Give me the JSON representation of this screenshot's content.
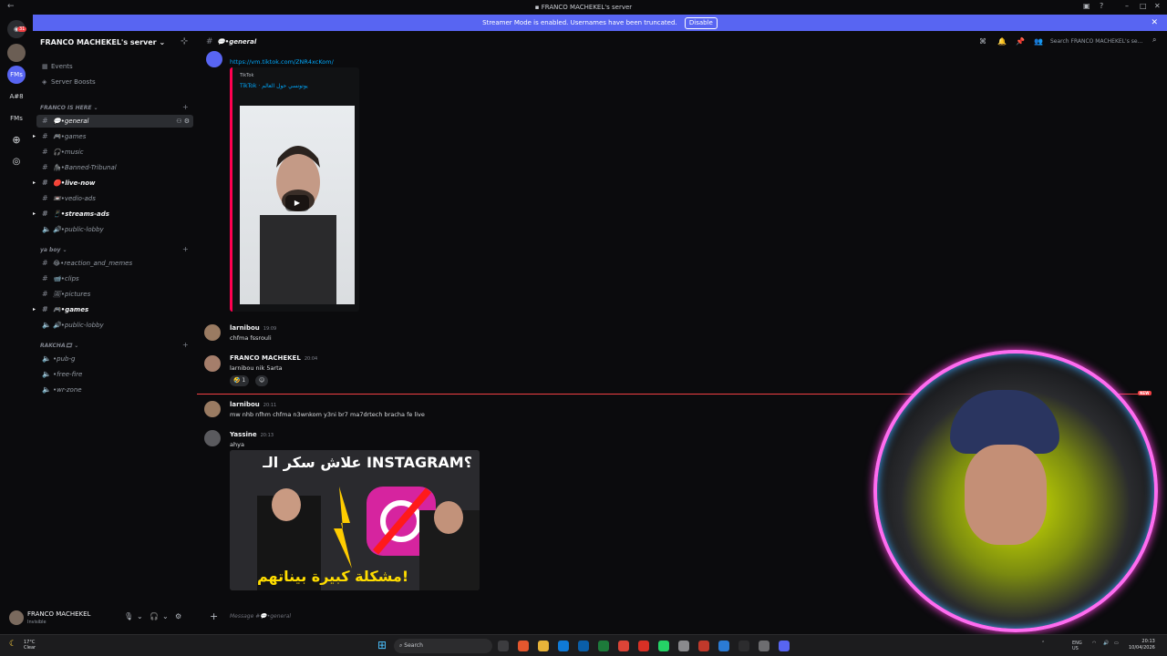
{
  "window": {
    "title": "FRANCO MACHEKEL's server"
  },
  "banner": {
    "text": "Streamer Mode is enabled. Usernames have been truncated.",
    "disable": "Disable"
  },
  "rail": {
    "badge": "31",
    "servers": [
      "FMs",
      "A#8",
      "FMs"
    ]
  },
  "sidebar": {
    "server_name": "FRANCO MACHEKEL's server",
    "nav": [
      "Events",
      "Server Boosts"
    ],
    "categories": [
      {
        "name": "FRANCO IS HERE",
        "channels": [
          {
            "name": "💬•general",
            "active": true
          },
          {
            "name": "🎮•games"
          },
          {
            "name": "🎧•music"
          },
          {
            "name": "🦍•Banned-Tribunal"
          },
          {
            "name": "🔴•live-now",
            "bright": true
          },
          {
            "name": "📼•vedio-ads"
          },
          {
            "name": "📱•streams-ads",
            "bright": true
          },
          {
            "name": "🔊•public-lobby",
            "voice": true
          }
        ]
      },
      {
        "name": "ya boy",
        "channels": [
          {
            "name": "😂•reaction_and_memes"
          },
          {
            "name": "📹•clips"
          },
          {
            "name": "🖼•pictures"
          },
          {
            "name": "🎮•games",
            "bright": true
          },
          {
            "name": "🔊•public-lobby",
            "voice": true
          }
        ]
      },
      {
        "name": "RAKCHA🎞",
        "channels": [
          {
            "name": "•pub-g",
            "voice": true
          },
          {
            "name": "•free-fire",
            "voice": true
          },
          {
            "name": "•wr-zone",
            "voice": true
          }
        ]
      }
    ]
  },
  "user": {
    "name": "FRANCO MACHEKEL",
    "status": "Invisible"
  },
  "channel": {
    "name": "💬•general",
    "search_placeholder": "Search FRANCO MACHEKEL's se..."
  },
  "messages": {
    "link": "https://vm.tiktok.com/ZNR4xcKom/",
    "embed_provider": "TikTok",
    "embed_title": "TikTok · يوتونسي حول العالم",
    "m1": {
      "author": "larnibou",
      "time": "19:09",
      "text": "chfma fssrouli"
    },
    "m2": {
      "author": "FRANCO MACHEKEL",
      "time": "20:04",
      "text": "larnibou nik 5arta",
      "reaction": "1"
    },
    "m3": {
      "author": "larnibou",
      "time": "20:11",
      "text": "mw nhb nfhm chfma n3wnkom y3ni br7 ma7drtech bracha fe live"
    },
    "m4": {
      "author": "Yassine",
      "time": "20:13",
      "text": "ahya"
    },
    "thumb_top": "علاش سكر الـ INSTAGRAM؟",
    "thumb_bottom": "مشكلة كبيرة بيناتهم!",
    "new_badge": "NEW"
  },
  "composer": {
    "placeholder": "Message #💬•general"
  },
  "taskbar": {
    "weather_temp": "17°C",
    "weather_desc": "Clear",
    "search": "Search",
    "lang": "ENG",
    "region": "US",
    "time": "20:13",
    "date": "10/04/2026"
  }
}
